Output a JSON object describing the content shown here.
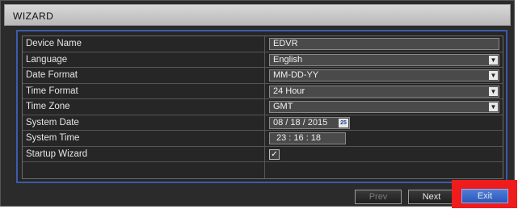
{
  "window": {
    "title": "WIZARD"
  },
  "form": {
    "rows": [
      {
        "label": "Device Name",
        "kind": "text",
        "value": "EDVR"
      },
      {
        "label": "Language",
        "kind": "select",
        "value": "English"
      },
      {
        "label": "Date Format",
        "kind": "select",
        "value": "MM-DD-YY"
      },
      {
        "label": "Time Format",
        "kind": "select",
        "value": "24 Hour"
      },
      {
        "label": "Time Zone",
        "kind": "select",
        "value": "GMT"
      },
      {
        "label": "System Date",
        "kind": "date",
        "value": "08 / 18 / 2015"
      },
      {
        "label": "System Time",
        "kind": "time",
        "value": "23 : 16 : 18"
      },
      {
        "label": "Startup Wizard",
        "kind": "checkbox",
        "value": "checked"
      },
      {
        "label": "",
        "kind": "empty",
        "value": ""
      }
    ],
    "calendar_icon_text": "25"
  },
  "buttons": {
    "prev": "Prev",
    "next": "Next",
    "exit": "Exit"
  },
  "colors": {
    "highlight": "#ee1c1c",
    "exit_button": "#2a58b8",
    "panel_border": "#3b5ca8"
  }
}
